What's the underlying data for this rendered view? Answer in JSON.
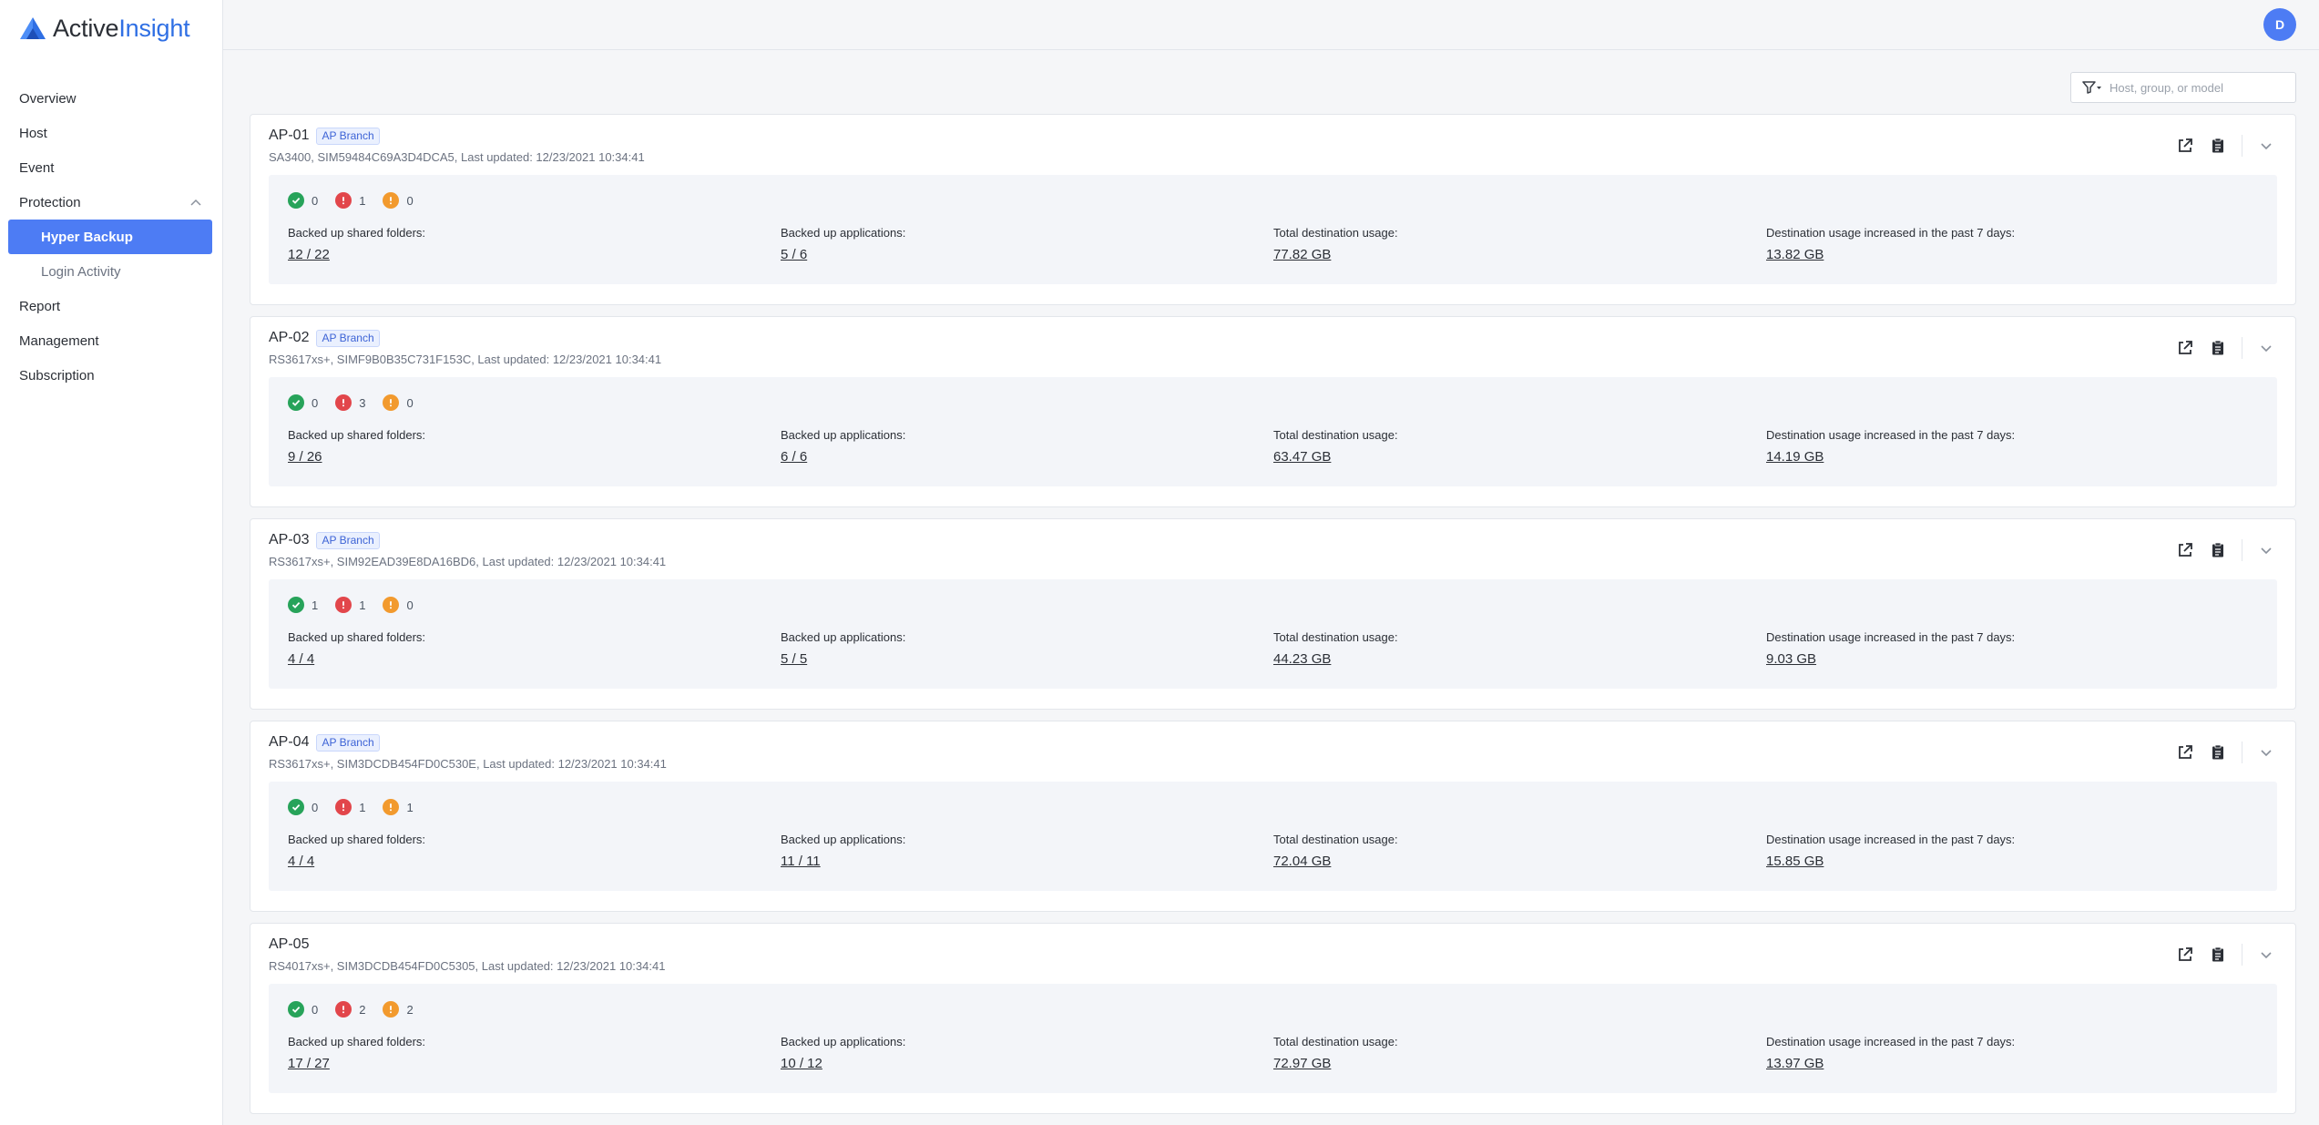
{
  "brand": {
    "name_part1": "Active",
    "name_part2": "Insight",
    "accent": "#2f6fe4"
  },
  "user": {
    "initial": "D"
  },
  "sidebar": {
    "items": [
      {
        "label": "Overview"
      },
      {
        "label": "Host"
      },
      {
        "label": "Event"
      },
      {
        "label": "Protection",
        "expanded": true
      },
      {
        "label": "Hyper Backup",
        "sub": true,
        "active": true
      },
      {
        "label": "Login Activity",
        "sub": true
      },
      {
        "label": "Report"
      },
      {
        "label": "Management"
      },
      {
        "label": "Subscription"
      }
    ]
  },
  "filter": {
    "placeholder": "Host, group, or model",
    "icon": "filter-icon"
  },
  "labels": {
    "folders": "Backed up shared folders:",
    "apps": "Backed up applications:",
    "usage": "Total destination usage:",
    "increase": "Destination usage increased in the past 7 days:"
  },
  "hosts": [
    {
      "name": "AP-01",
      "badge": "AP Branch",
      "info": "SA3400, SIM59484C69A3D4DCA5, Last updated: 12/23/2021 10:34:41",
      "ok": "0",
      "error": "1",
      "warning": "0",
      "folders": "12 / 22",
      "apps": "5 / 6",
      "usage": "77.82 GB",
      "increase": "13.82 GB"
    },
    {
      "name": "AP-02",
      "badge": "AP Branch",
      "info": "RS3617xs+, SIMF9B0B35C731F153C, Last updated: 12/23/2021 10:34:41",
      "ok": "0",
      "error": "3",
      "warning": "0",
      "folders": "9 / 26",
      "apps": "6 / 6",
      "usage": "63.47 GB",
      "increase": "14.19 GB"
    },
    {
      "name": "AP-03",
      "badge": "AP Branch",
      "info": "RS3617xs+, SIM92EAD39E8DA16BD6, Last updated: 12/23/2021 10:34:41",
      "ok": "1",
      "error": "1",
      "warning": "0",
      "folders": "4 / 4",
      "apps": "5 / 5",
      "usage": "44.23 GB",
      "increase": "9.03 GB"
    },
    {
      "name": "AP-04",
      "badge": "AP Branch",
      "info": "RS3617xs+, SIM3DCDB454FD0C530E, Last updated: 12/23/2021 10:34:41",
      "ok": "0",
      "error": "1",
      "warning": "1",
      "folders": "4 / 4",
      "apps": "11 / 11",
      "usage": "72.04 GB",
      "increase": "15.85 GB"
    },
    {
      "name": "AP-05",
      "badge": "",
      "info": "RS4017xs+, SIM3DCDB454FD0C5305, Last updated: 12/23/2021 10:34:41",
      "ok": "0",
      "error": "2",
      "warning": "2",
      "folders": "17 / 27",
      "apps": "10 / 12",
      "usage": "72.97 GB",
      "increase": "13.97 GB"
    }
  ],
  "colors": {
    "active_nav": "#4d7cf4",
    "ok": "#27a35a",
    "error": "#e2464b",
    "warning": "#f29a2e"
  }
}
